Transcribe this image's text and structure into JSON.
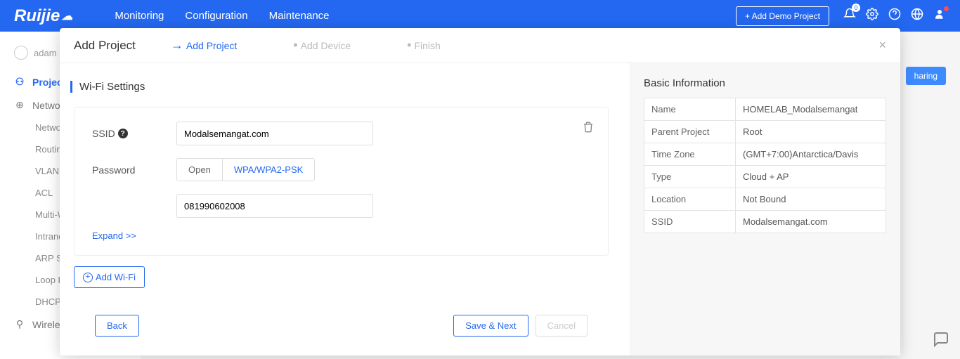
{
  "brand": "Ruijie",
  "nav": {
    "monitoring": "Monitoring",
    "configuration": "Configuration",
    "maintenance": "Maintenance"
  },
  "add_demo": "+ Add Demo Project",
  "notif_count": "0",
  "user_name": "adam",
  "sidebar": {
    "project": "Project",
    "network": "Network",
    "subs": [
      "Network",
      "Routing",
      "VLAN",
      "ACL",
      "Multi-W",
      "Intranet",
      "ARP S",
      "Loop P",
      "DHCP"
    ],
    "wireless": "Wireless"
  },
  "sharing": "haring",
  "modal": {
    "title": "Add Project",
    "steps": {
      "s1": "Add Project",
      "s2": "Add Device",
      "s3": "Finish"
    },
    "section": "Wi-Fi Settings",
    "ssid_label": "SSID",
    "ssid_value": "Modalsemangat.com",
    "password_label": "Password",
    "seg_open": "Open",
    "seg_wpa": "WPA/WPA2-PSK",
    "password_value": "081990602008",
    "expand": "Expand >>",
    "add_wifi": "Add Wi-Fi",
    "back": "Back",
    "save_next": "Save & Next",
    "cancel": "Cancel"
  },
  "info": {
    "title": "Basic Information",
    "rows": [
      {
        "k": "Name",
        "v": "HOMELAB_Modalsemangat"
      },
      {
        "k": "Parent Project",
        "v": "Root"
      },
      {
        "k": "Time Zone",
        "v": "(GMT+7:00)Antarctica/Davis"
      },
      {
        "k": "Type",
        "v": "Cloud + AP"
      },
      {
        "k": "Location",
        "v": "Not Bound"
      },
      {
        "k": "SSID",
        "v": "Modalsemangat.com"
      }
    ]
  }
}
